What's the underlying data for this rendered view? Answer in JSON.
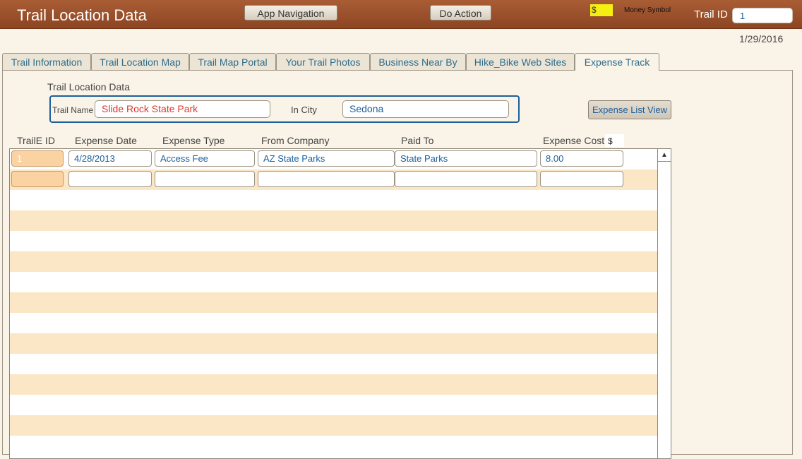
{
  "header": {
    "title": "Trail Location Data",
    "app_nav_label": "App Navigation",
    "do_action_label": "Do Action",
    "money_symbol_value": "$",
    "money_symbol_label": "Money Symbol",
    "trail_id_label": "Trail ID",
    "trail_id_value": "1"
  },
  "date": "1/29/2016",
  "tabs": [
    {
      "label": "Trail Information"
    },
    {
      "label": "Trail Location Map"
    },
    {
      "label": "Trail Map Portal"
    },
    {
      "label": "Your Trail Photos"
    },
    {
      "label": "Business Near By"
    },
    {
      "label": "Hike_Bike Web Sites"
    },
    {
      "label": "Expense Track",
      "active": true
    }
  ],
  "location": {
    "section_title": "Trail Location Data",
    "trail_name_label": "Trail Name",
    "trail_name_value": "Slide Rock State Park",
    "city_label": "In City",
    "city_value": "Sedona",
    "expense_list_button": "Expense List View"
  },
  "table": {
    "headers": {
      "trail_id": "TrailE ID",
      "expense_date": "Expense Date",
      "expense_type": "Expense Type",
      "from_company": "From Company",
      "paid_to": "Paid To",
      "expense_cost": "Expense Cost",
      "currency": "$"
    },
    "rows": [
      {
        "trail_id": "1",
        "expense_date": "4/28/2013",
        "expense_type": "Access Fee",
        "from_company": "AZ State Parks",
        "paid_to": "State Parks",
        "expense_cost": "8.00"
      },
      {
        "trail_id": "",
        "expense_date": "",
        "expense_type": "",
        "from_company": "",
        "paid_to": "",
        "expense_cost": ""
      }
    ]
  },
  "colors": {
    "header_bg": "#9b4f2b",
    "accent_blue": "#1d5f9a",
    "row_stripe": "#fbe6c5",
    "money_highlight": "#f5ee13"
  }
}
